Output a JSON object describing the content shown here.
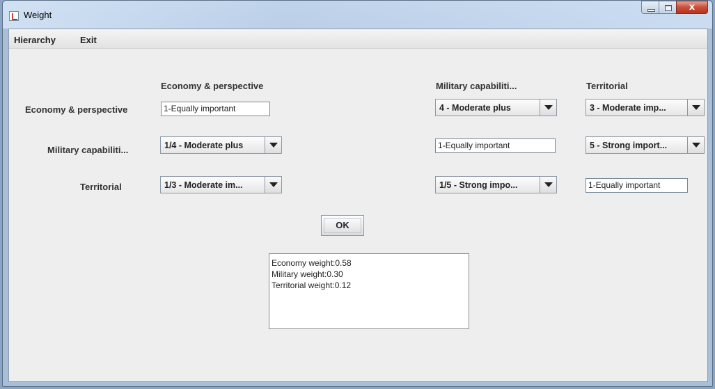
{
  "window": {
    "title": "Weight"
  },
  "menu": [
    "Hierarchy",
    "Exit"
  ],
  "criteria": [
    "Economy & perspective",
    "Military capabiliti...",
    "Territorial"
  ],
  "row_labels": [
    "Economy & perspective",
    "Military capabiliti...",
    "Territorial"
  ],
  "cells": {
    "r0c0": "1-Equally important",
    "r0c1": "4 - Moderate plus",
    "r0c2": "3 - Moderate imp...",
    "r1c0": "1/4 - Moderate plus",
    "r1c1": "1-Equally important",
    "r1c2": "5 - Strong import...",
    "r2c0": "1/3 - Moderate im...",
    "r2c1": "1/5 - Strong impo...",
    "r2c2": "1-Equally important"
  },
  "ok_label": "OK",
  "results": [
    "Economy weight:0.58",
    "Military weight:0.30",
    "Territorial weight:0.12"
  ],
  "colors": {
    "title_bar": "#bcd0e8",
    "close_button": "#c7503a",
    "client_bg": "#eeeeee"
  }
}
